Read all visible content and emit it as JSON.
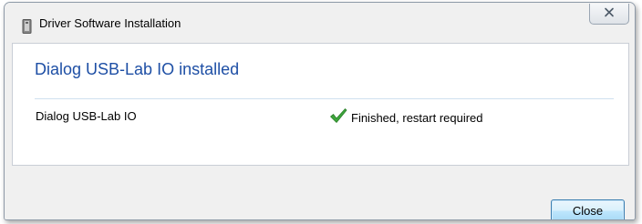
{
  "window": {
    "title": "Driver Software Installation"
  },
  "content": {
    "headline": "Dialog USB-Lab IO installed",
    "device_name": "Dialog USB-Lab IO",
    "status": "Finished, restart required",
    "status_icon": "green-checkmark-icon"
  },
  "footer": {
    "close_label": "Close"
  },
  "colors": {
    "headline": "#1e4fa5",
    "checkmark": "#3ea63c",
    "window_bg": "#f0f0f0"
  }
}
